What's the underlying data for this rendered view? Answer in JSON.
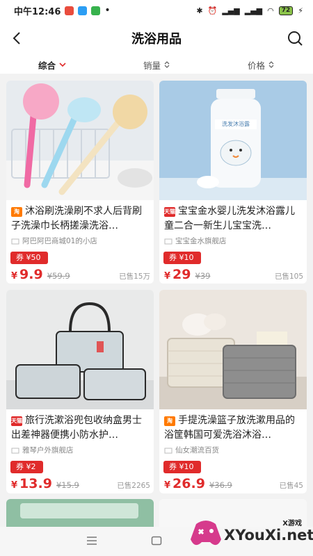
{
  "status": {
    "time": "中午12:46",
    "battery": "72"
  },
  "header": {
    "title": "洗浴用品"
  },
  "sort_tabs": [
    {
      "label": "综合",
      "active": true
    },
    {
      "label": "销量",
      "active": false
    },
    {
      "label": "价格",
      "active": false
    }
  ],
  "products": [
    {
      "platform": "淘",
      "platform_color": "#ff7a00",
      "title": "沐浴刷洗澡刷不求人后背刷子洗澡巾长柄搓澡洗浴…",
      "shop": "阿巴阿巴商城01的小店",
      "coupon": "券 ¥50",
      "currency": "¥",
      "price": "9.9",
      "original": "¥59.9",
      "sold": "已售15万"
    },
    {
      "platform": "天猫",
      "platform_color": "#e02b2b",
      "title": "宝宝金水婴儿洗发沐浴露儿童二合一新生儿宝宝洗…",
      "shop": "宝宝金水旗舰店",
      "coupon": "券 ¥10",
      "currency": "¥",
      "price": "29",
      "original": "¥39",
      "sold": "已售105",
      "bottle_label": "洗发沐浴露"
    },
    {
      "platform": "天猫",
      "platform_color": "#e02b2b",
      "title": "旅行洗漱浴兜包收纳盒男士出差神器便携小防水护…",
      "shop": "雅琴户外旗舰店",
      "coupon": "券 ¥2",
      "currency": "¥",
      "price": "13.9",
      "original": "¥15.9",
      "sold": "已售2265"
    },
    {
      "platform": "淘",
      "platform_color": "#ff7a00",
      "title": "手提洗澡篮子放洗漱用品的浴筐韩国可爱洗浴沐浴…",
      "shop": "仙女潮流百货",
      "coupon": "券 ¥10",
      "currency": "¥",
      "price": "26.9",
      "original": "¥36.9",
      "sold": "已售45"
    }
  ],
  "watermark": {
    "small": "X游戏",
    "big": "XYouXi.net"
  },
  "colors": {
    "accent": "#e02b2b",
    "taobao": "#ff7a00"
  }
}
